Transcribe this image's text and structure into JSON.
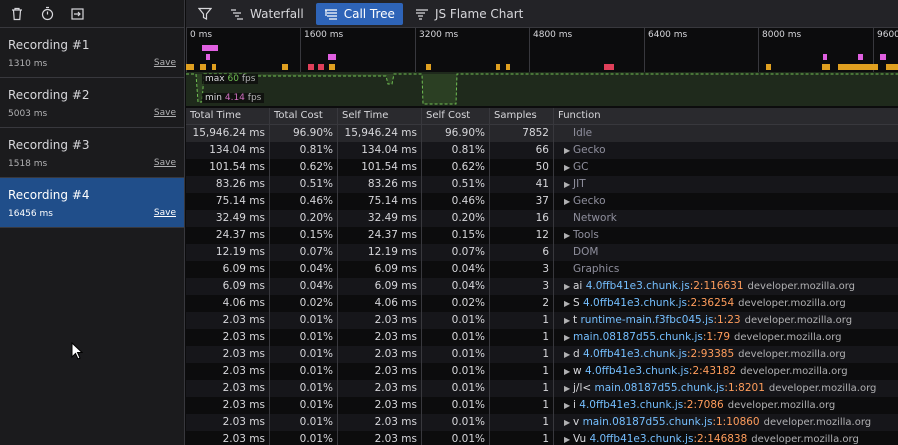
{
  "sidebar": {
    "recordings": [
      {
        "title": "Recording #1",
        "duration": "1310 ms",
        "save": "Save",
        "selected": false
      },
      {
        "title": "Recording #2",
        "duration": "5003 ms",
        "save": "Save",
        "selected": false
      },
      {
        "title": "Recording #3",
        "duration": "1518 ms",
        "save": "Save",
        "selected": false
      },
      {
        "title": "Recording #4",
        "duration": "16456 ms",
        "save": "Save",
        "selected": true
      }
    ]
  },
  "toolbar": {
    "tabs": [
      {
        "label": "Waterfall",
        "active": false
      },
      {
        "label": "Call Tree",
        "active": true
      },
      {
        "label": "JS Flame Chart",
        "active": false
      }
    ]
  },
  "overview": {
    "ticks": [
      "0 ms",
      "1600 ms",
      "3200 ms",
      "4800 ms",
      "6400 ms",
      "8000 ms",
      "9600"
    ],
    "fps_max_label": "max",
    "fps_max_value": "60",
    "fps_min_label": "min",
    "fps_min_value": "4.14",
    "fps_unit": "fps"
  },
  "table": {
    "headers": [
      "Total Time",
      "Total Cost",
      "Self Time",
      "Self Cost",
      "Samples",
      "Function"
    ],
    "rows": [
      {
        "total_time": "15,946.24 ms",
        "total_cost": "96.90%",
        "self_time": "15,946.24 ms",
        "self_cost": "96.90%",
        "samples": "7852",
        "twisty": false,
        "name": "Idle",
        "kind": "cat"
      },
      {
        "total_time": "134.04 ms",
        "total_cost": "0.81%",
        "self_time": "134.04 ms",
        "self_cost": "0.81%",
        "samples": "66",
        "twisty": true,
        "name": "Gecko",
        "kind": "cat"
      },
      {
        "total_time": "101.54 ms",
        "total_cost": "0.62%",
        "self_time": "101.54 ms",
        "self_cost": "0.62%",
        "samples": "50",
        "twisty": true,
        "name": "GC",
        "kind": "cat"
      },
      {
        "total_time": "83.26 ms",
        "total_cost": "0.51%",
        "self_time": "83.26 ms",
        "self_cost": "0.51%",
        "samples": "41",
        "twisty": true,
        "name": "JIT",
        "kind": "cat"
      },
      {
        "total_time": "75.14 ms",
        "total_cost": "0.46%",
        "self_time": "75.14 ms",
        "self_cost": "0.46%",
        "samples": "37",
        "twisty": true,
        "name": "Gecko",
        "kind": "cat"
      },
      {
        "total_time": "32.49 ms",
        "total_cost": "0.20%",
        "self_time": "32.49 ms",
        "self_cost": "0.20%",
        "samples": "16",
        "twisty": false,
        "name": "Network",
        "kind": "cat"
      },
      {
        "total_time": "24.37 ms",
        "total_cost": "0.15%",
        "self_time": "24.37 ms",
        "self_cost": "0.15%",
        "samples": "12",
        "twisty": true,
        "name": "Tools",
        "kind": "cat"
      },
      {
        "total_time": "12.19 ms",
        "total_cost": "0.07%",
        "self_time": "12.19 ms",
        "self_cost": "0.07%",
        "samples": "6",
        "twisty": false,
        "name": "DOM",
        "kind": "cat"
      },
      {
        "total_time": "6.09 ms",
        "total_cost": "0.04%",
        "self_time": "6.09 ms",
        "self_cost": "0.04%",
        "samples": "3",
        "twisty": false,
        "name": "Graphics",
        "kind": "cat"
      },
      {
        "total_time": "6.09 ms",
        "total_cost": "0.04%",
        "self_time": "6.09 ms",
        "self_cost": "0.04%",
        "samples": "3",
        "twisty": true,
        "name": "ai",
        "file": "4.0ffb41e3.chunk.js",
        "line": ":2:116631",
        "host": "developer.mozilla.org",
        "kind": "js"
      },
      {
        "total_time": "4.06 ms",
        "total_cost": "0.02%",
        "self_time": "4.06 ms",
        "self_cost": "0.02%",
        "samples": "2",
        "twisty": true,
        "name": "S",
        "file": "4.0ffb41e3.chunk.js",
        "line": ":2:36254",
        "host": "developer.mozilla.org",
        "kind": "js"
      },
      {
        "total_time": "2.03 ms",
        "total_cost": "0.01%",
        "self_time": "2.03 ms",
        "self_cost": "0.01%",
        "samples": "1",
        "twisty": true,
        "name": "t",
        "file": "runtime-main.f3fbc045.js",
        "line": ":1:23",
        "host": "developer.mozilla.org",
        "kind": "js"
      },
      {
        "total_time": "2.03 ms",
        "total_cost": "0.01%",
        "self_time": "2.03 ms",
        "self_cost": "0.01%",
        "samples": "1",
        "twisty": true,
        "name": "",
        "file": "main.08187d55.chunk.js",
        "line": ":1:79",
        "host": "developer.mozilla.org",
        "kind": "js"
      },
      {
        "total_time": "2.03 ms",
        "total_cost": "0.01%",
        "self_time": "2.03 ms",
        "self_cost": "0.01%",
        "samples": "1",
        "twisty": true,
        "name": "d",
        "file": "4.0ffb41e3.chunk.js",
        "line": ":2:93385",
        "host": "developer.mozilla.org",
        "kind": "js"
      },
      {
        "total_time": "2.03 ms",
        "total_cost": "0.01%",
        "self_time": "2.03 ms",
        "self_cost": "0.01%",
        "samples": "1",
        "twisty": true,
        "name": "w",
        "file": "4.0ffb41e3.chunk.js",
        "line": ":2:43182",
        "host": "developer.mozilla.org",
        "kind": "js"
      },
      {
        "total_time": "2.03 ms",
        "total_cost": "0.01%",
        "self_time": "2.03 ms",
        "self_cost": "0.01%",
        "samples": "1",
        "twisty": true,
        "name": "j/l<",
        "file": "main.08187d55.chunk.js",
        "line": ":1:8201",
        "host": "developer.mozilla.org",
        "kind": "js"
      },
      {
        "total_time": "2.03 ms",
        "total_cost": "0.01%",
        "self_time": "2.03 ms",
        "self_cost": "0.01%",
        "samples": "1",
        "twisty": true,
        "name": "i",
        "file": "4.0ffb41e3.chunk.js",
        "line": ":2:7086",
        "host": "developer.mozilla.org",
        "kind": "js"
      },
      {
        "total_time": "2.03 ms",
        "total_cost": "0.01%",
        "self_time": "2.03 ms",
        "self_cost": "0.01%",
        "samples": "1",
        "twisty": true,
        "name": "v",
        "file": "main.08187d55.chunk.js",
        "line": ":1:10860",
        "host": "developer.mozilla.org",
        "kind": "js"
      },
      {
        "total_time": "2.03 ms",
        "total_cost": "0.01%",
        "self_time": "2.03 ms",
        "self_cost": "0.01%",
        "samples": "1",
        "twisty": true,
        "name": "Vu",
        "file": "4.0ffb41e3.chunk.js",
        "line": ":2:146838",
        "host": "developer.mozilla.org",
        "kind": "js"
      }
    ]
  },
  "colors": {
    "accent": "#2e64b8",
    "selected_recording": "#204e8a",
    "marker_pink": "#e060e0",
    "marker_orange": "#e0a020",
    "marker_red": "#e0405a",
    "fps_green": "#70bf53",
    "file_blue": "#75bfff",
    "line_orange": "#ff9d5c"
  }
}
